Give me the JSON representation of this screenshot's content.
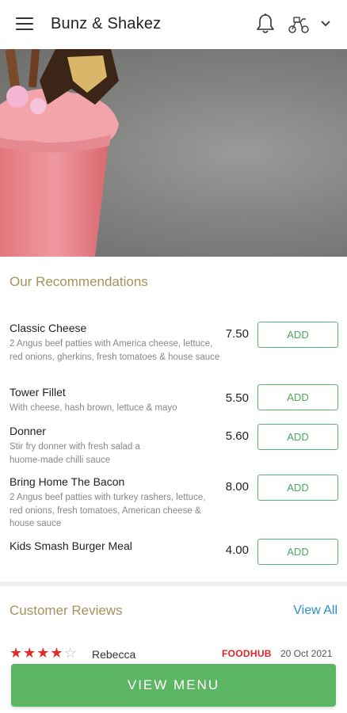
{
  "header": {
    "title": "Bunz & Shakez",
    "icons": [
      "menu-icon",
      "bell-icon",
      "delivery-scooter-icon",
      "chevron-down-icon"
    ]
  },
  "recommendations": {
    "title": "Our Recommendations",
    "items": [
      {
        "name": "Classic Cheese",
        "description": "2 Angus beef patties with America cheese, lettuce, red onions, gherkins, fresh tomatoes & house sauce",
        "price": "7.50",
        "add_label": "ADD"
      },
      {
        "name": "Tower Fillet",
        "description": "With cheese, hash brown, lettuce & mayo",
        "price": "5.50",
        "add_label": "ADD"
      },
      {
        "name": "Donner",
        "description": "Stir fry donner with fresh salad a huome-made chilli sauce",
        "price": "5.60",
        "add_label": "ADD"
      },
      {
        "name": "Bring Home The Bacon",
        "description": "2 Angus beef patties with turkey rashers, lettuce, red onions, fresh tomatoes, American cheese & house sauce",
        "price": "8.00",
        "add_label": "ADD"
      },
      {
        "name": "Kids Smash Burger Meal",
        "description": "",
        "price": "4.00",
        "add_label": "ADD"
      }
    ]
  },
  "reviews": {
    "title": "Customer Reviews",
    "view_all": "View All",
    "items": [
      {
        "rating": 4,
        "max_rating": 5,
        "reviewer": "Rebecca",
        "source": "FOODHUB",
        "date": "20 Oct 2021"
      }
    ]
  },
  "footer": {
    "view_menu_label": "VIEW MENU"
  },
  "colors": {
    "accent_gold": "#a8925c",
    "add_green": "#4aa95a",
    "view_menu_green": "#5bb562",
    "link_blue": "#2b8fc4",
    "star_red": "#e12c2c",
    "foodhub_red": "#e0242a"
  }
}
